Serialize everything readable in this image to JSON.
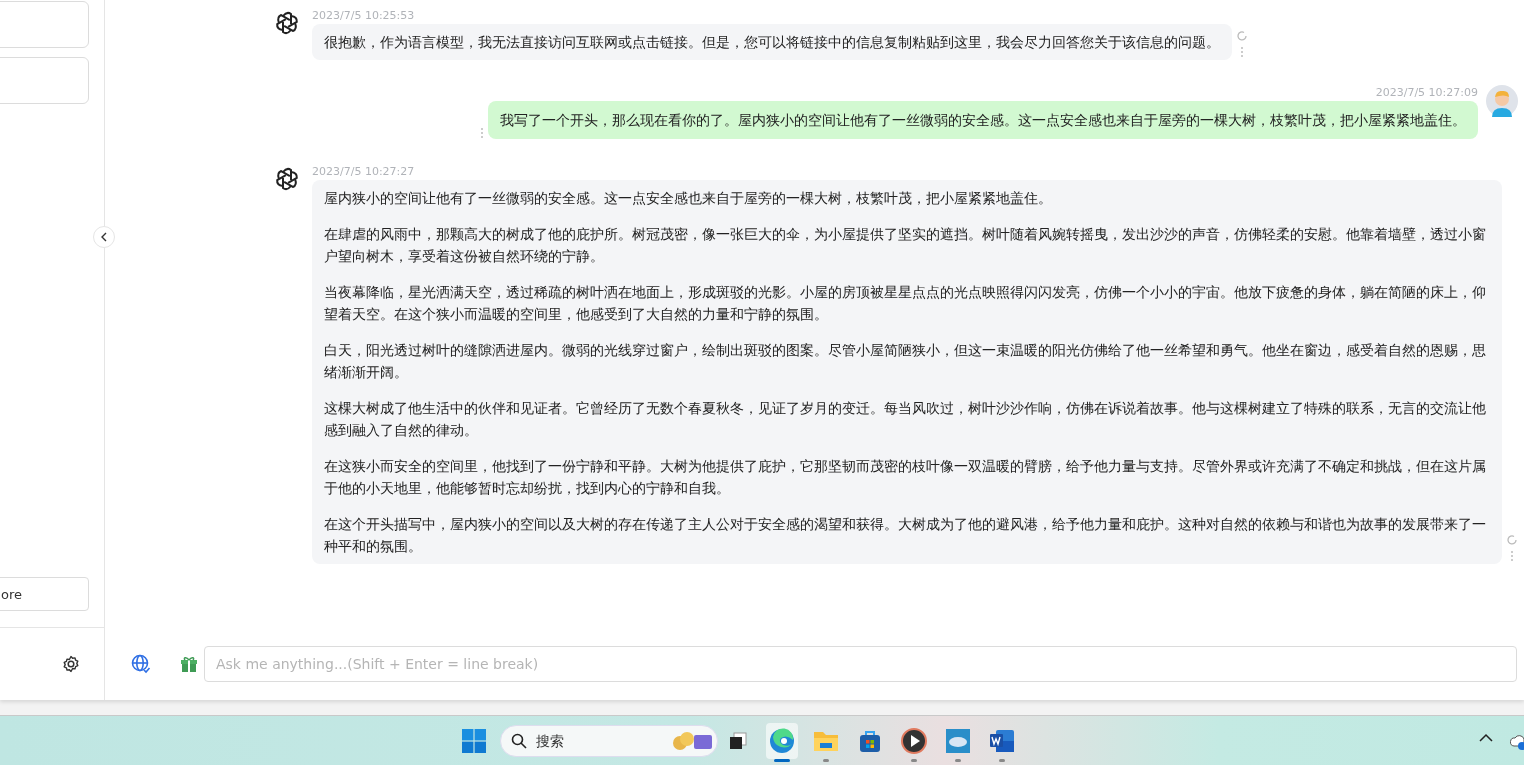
{
  "sidebar": {
    "more_button": {
      "label": "ore"
    }
  },
  "messages": [
    {
      "kind": "assistant",
      "time": "2023/7/5 10:25:53",
      "paragraphs": [
        "很抱歉，作为语言模型，我无法直接访问互联网或点击链接。但是，您可以将链接中的信息复制粘贴到这里，我会尽力回答您关于该信息的问题。"
      ]
    },
    {
      "kind": "user",
      "time": "2023/7/5 10:27:09",
      "paragraphs": [
        "我写了一个开头，那么现在看你的了。屋内狭小的空间让他有了一丝微弱的安全感。这一点安全感也来自于屋旁的一棵大树，枝繁叶茂，把小屋紧紧地盖住。"
      ]
    },
    {
      "kind": "assistant",
      "time": "2023/7/5 10:27:27",
      "paragraphs": [
        "屋内狭小的空间让他有了一丝微弱的安全感。这一点安全感也来自于屋旁的一棵大树，枝繁叶茂，把小屋紧紧地盖住。",
        "在肆虐的风雨中，那颗高大的树成了他的庇护所。树冠茂密，像一张巨大的伞，为小屋提供了坚实的遮挡。树叶随着风婉转摇曳，发出沙沙的声音，仿佛轻柔的安慰。他靠着墙壁，透过小窗户望向树木，享受着这份被自然环绕的宁静。",
        "当夜幕降临，星光洒满天空，透过稀疏的树叶洒在地面上，形成斑驳的光影。小屋的房顶被星星点点的光点映照得闪闪发亮，仿佛一个小小的宇宙。他放下疲惫的身体，躺在简陋的床上，仰望着天空。在这个狭小而温暖的空间里，他感受到了大自然的力量和宁静的氛围。",
        "白天，阳光透过树叶的缝隙洒进屋内。微弱的光线穿过窗户，绘制出斑驳的图案。尽管小屋简陋狭小，但这一束温暖的阳光仿佛给了他一丝希望和勇气。他坐在窗边，感受着自然的恩赐，思绪渐渐开阔。",
        "这棵大树成了他生活中的伙伴和见证者。它曾经历了无数个春夏秋冬，见证了岁月的变迁。每当风吹过，树叶沙沙作响，仿佛在诉说着故事。他与这棵树建立了特殊的联系，无言的交流让他感到融入了自然的律动。",
        "在这狭小而安全的空间里，他找到了一份宁静和平静。大树为他提供了庇护，它那坚韧而茂密的枝叶像一双温暖的臂膀，给予他力量与支持。尽管外界或许充满了不确定和挑战，但在这片属于他的小天地里，他能够暂时忘却纷扰，找到内心的宁静和自我。",
        "在这个开头描写中，屋内狭小的空间以及大树的存在传递了主人公对于安全感的渴望和获得。大树成为了他的避风港，给予他力量和庇护。这种对自然的依赖与和谐也为故事的发展带来了一种平和的氛围。"
      ]
    }
  ],
  "input": {
    "placeholder": "Ask me anything...(Shift + Enter = line break)"
  },
  "taskbar": {
    "search": {
      "placeholder": "搜索"
    },
    "apps": [
      {
        "kind": "taskview",
        "selected": false,
        "running": false
      },
      {
        "kind": "browser",
        "selected": true,
        "running": true
      },
      {
        "kind": "folder",
        "selected": false,
        "running": true
      },
      {
        "kind": "store",
        "selected": false,
        "running": false
      },
      {
        "kind": "player",
        "selected": false,
        "running": true
      },
      {
        "kind": "picture",
        "selected": false,
        "running": true
      },
      {
        "kind": "word",
        "selected": false,
        "running": true
      }
    ]
  }
}
